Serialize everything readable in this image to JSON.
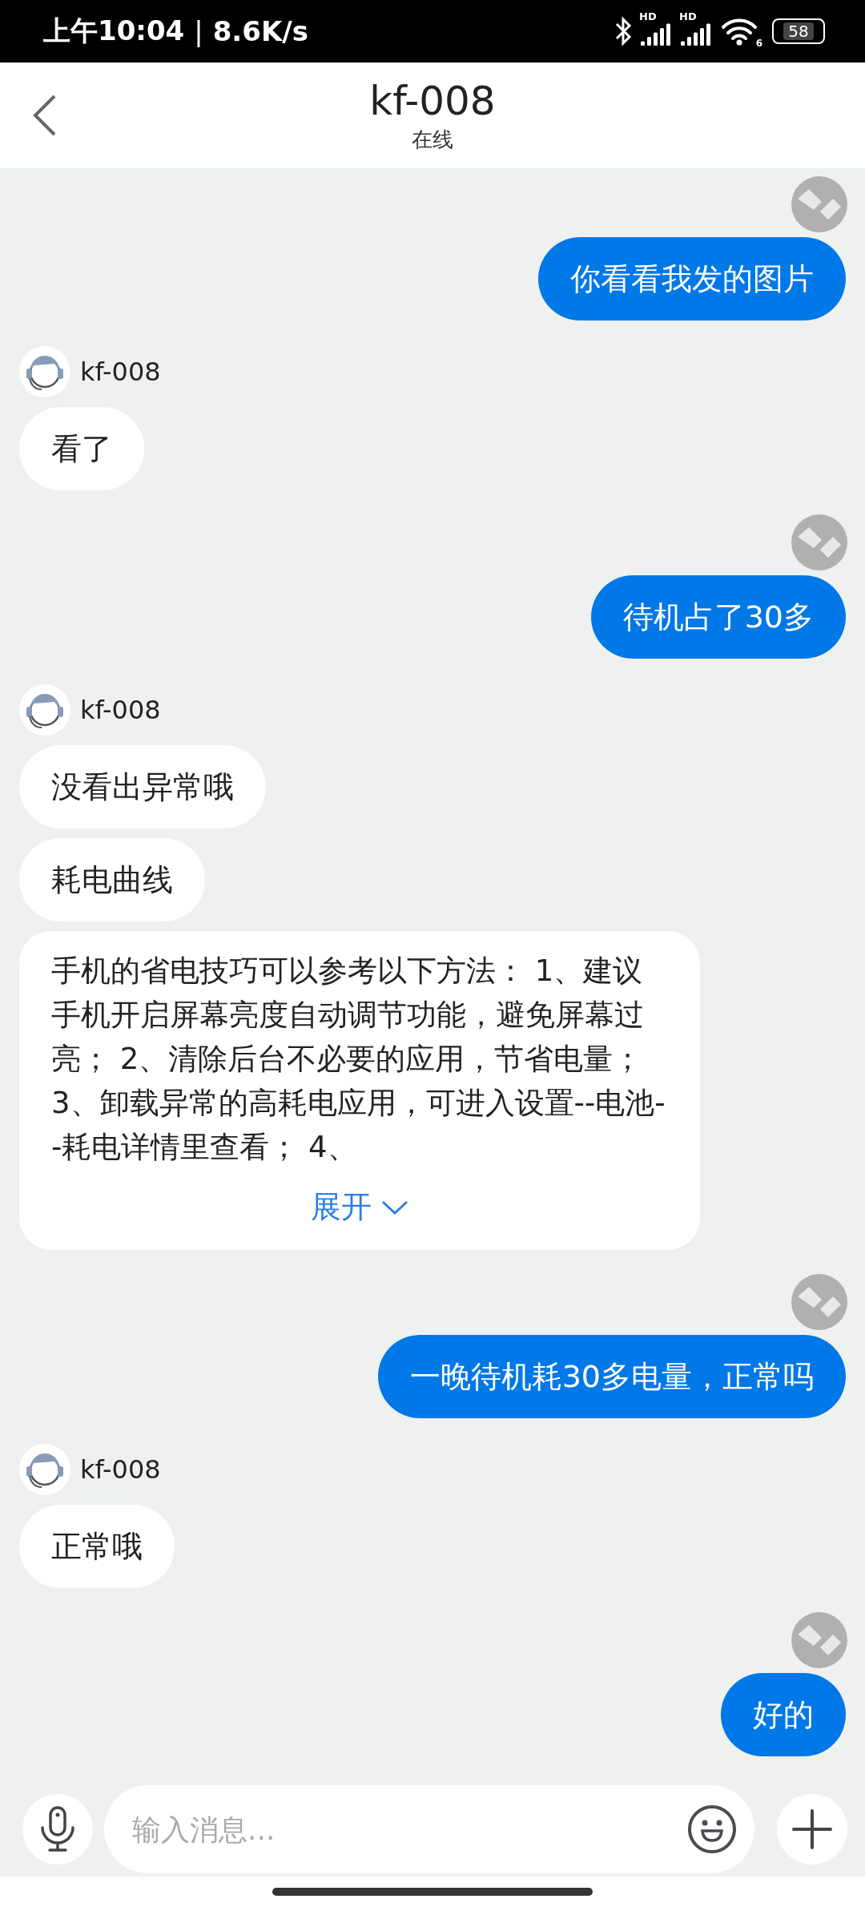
{
  "status_bar": {
    "time": "上午10:04",
    "separator": "|",
    "speed": "8.6K/s",
    "signal_labels": [
      "HD",
      "HD"
    ],
    "wifi_label": "6",
    "battery": "58"
  },
  "header": {
    "title": "kf-008",
    "subtitle": "在线"
  },
  "messages": [
    {
      "kind": "sent",
      "bubbles": [
        {
          "kind": "text",
          "text": "你看看我发的图片"
        }
      ]
    },
    {
      "kind": "received",
      "name": "kf-008",
      "bubbles": [
        {
          "kind": "text",
          "text": "看了"
        }
      ]
    },
    {
      "kind": "sent",
      "bubbles": [
        {
          "kind": "text",
          "text": "待机占了30多"
        }
      ]
    },
    {
      "kind": "received",
      "name": "kf-008",
      "bubbles": [
        {
          "kind": "text",
          "text": "没看出异常哦"
        },
        {
          "kind": "text",
          "text": "耗电曲线"
        },
        {
          "kind": "collapsed",
          "text": "手机的省电技巧可以参考以下方法： 1、建议手机开启屏幕亮度自动调节功能，避免屏幕过亮； 2、清除后台不必要的应用，节省电量； 3、卸载异常的高耗电应用，可进入设置--电池--耗电详情里查看； 4、",
          "expand_label": "展开"
        }
      ]
    },
    {
      "kind": "sent",
      "bubbles": [
        {
          "kind": "text",
          "text": "一晚待机耗30多电量，正常吗"
        }
      ]
    },
    {
      "kind": "received",
      "name": "kf-008",
      "bubbles": [
        {
          "kind": "text",
          "text": "正常哦"
        }
      ]
    },
    {
      "kind": "sent",
      "bubbles": [
        {
          "kind": "text",
          "text": "好的"
        }
      ]
    }
  ],
  "input": {
    "placeholder": "输入消息..."
  }
}
